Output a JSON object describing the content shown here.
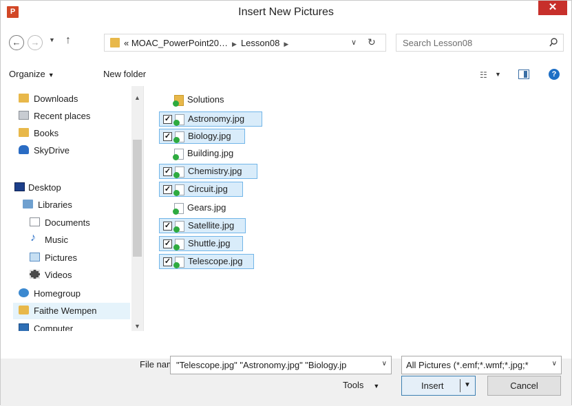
{
  "window": {
    "title": "Insert New Pictures",
    "app_icon": "P"
  },
  "address": {
    "segments": [
      "« MOAC_PowerPoint20…",
      "Lesson08"
    ],
    "search_placeholder": "Search Lesson08"
  },
  "toolbar": {
    "organize": "Organize",
    "new_folder": "New folder"
  },
  "nav": {
    "items": [
      {
        "label": "Downloads",
        "icon": "downloads-folder-icon"
      },
      {
        "label": "Recent places",
        "icon": "recent-places-icon"
      },
      {
        "label": "Books",
        "icon": "folder-icon"
      },
      {
        "label": "SkyDrive",
        "icon": "skydrive-icon"
      },
      {
        "label": "Desktop",
        "icon": "desktop-icon"
      },
      {
        "label": "Libraries",
        "icon": "libraries-icon"
      },
      {
        "label": "Documents",
        "icon": "documents-icon"
      },
      {
        "label": "Music",
        "icon": "music-icon"
      },
      {
        "label": "Pictures",
        "icon": "pictures-icon"
      },
      {
        "label": "Videos",
        "icon": "videos-icon"
      },
      {
        "label": "Homegroup",
        "icon": "homegroup-icon"
      },
      {
        "label": "Faithe Wempen",
        "icon": "user-folder-icon",
        "selected": true
      },
      {
        "label": "Computer",
        "icon": "computer-icon"
      }
    ]
  },
  "files": [
    {
      "name": "Solutions",
      "type": "folder",
      "selected": false
    },
    {
      "name": "Astronomy.jpg",
      "type": "image",
      "selected": true
    },
    {
      "name": "Biology.jpg",
      "type": "image",
      "selected": true
    },
    {
      "name": "Building.jpg",
      "type": "image",
      "selected": false
    },
    {
      "name": "Chemistry.jpg",
      "type": "image",
      "selected": true
    },
    {
      "name": "Circuit.jpg",
      "type": "image",
      "selected": true
    },
    {
      "name": "Gears.jpg",
      "type": "image",
      "selected": false
    },
    {
      "name": "Satellite.jpg",
      "type": "image",
      "selected": true
    },
    {
      "name": "Shuttle.jpg",
      "type": "image",
      "selected": true
    },
    {
      "name": "Telescope.jpg",
      "type": "image",
      "selected": true
    }
  ],
  "bottom": {
    "file_name_label": "File name:",
    "file_name_value": "\"Telescope.jpg\" \"Astronomy.jpg\" \"Biology.jp",
    "file_type_value": "All Pictures (*.emf;*.wmf;*.jpg;*",
    "tools_label": "Tools",
    "insert_label": "Insert",
    "cancel_label": "Cancel"
  }
}
